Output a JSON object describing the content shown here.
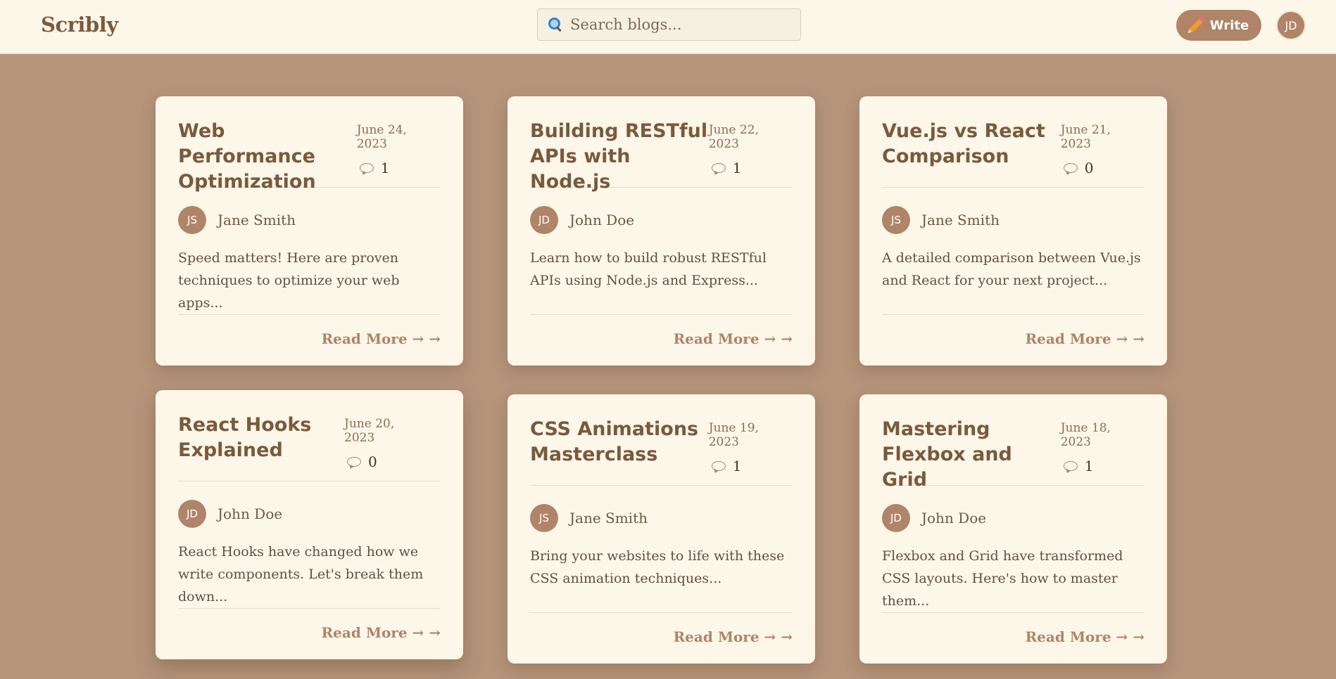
{
  "header": {
    "brand": "Scribly",
    "search_placeholder": "Search blogs...",
    "write_label": "Write",
    "user_initials": "JD"
  },
  "posts": [
    {
      "title": "Web Performance Optimization",
      "date": "June 24, 2023",
      "comments": "1",
      "initials": "JS",
      "author": "Jane Smith",
      "excerpt": "Speed matters! Here are proven techniques to optimize your web apps...",
      "read_more": "Read More → →"
    },
    {
      "title": "Building RESTful APIs with Node.js",
      "date": "June 22, 2023",
      "comments": "1",
      "initials": "JD",
      "author": "John Doe",
      "excerpt": "Learn how to build robust RESTful APIs using Node.js and Express...",
      "read_more": "Read More → →"
    },
    {
      "title": "Vue.js vs React Comparison",
      "date": "June 21, 2023",
      "comments": "0",
      "initials": "JS",
      "author": "Jane Smith",
      "excerpt": "A detailed comparison between Vue.js and React for your next project...",
      "read_more": "Read More → →"
    },
    {
      "title": "React Hooks Explained",
      "date": "June 20, 2023",
      "comments": "0",
      "initials": "JD",
      "author": "John Doe",
      "excerpt": "React Hooks have changed how we write components. Let's break them down...",
      "read_more": "Read More → →"
    },
    {
      "title": "CSS Animations Masterclass",
      "date": "June 19, 2023",
      "comments": "1",
      "initials": "JS",
      "author": "Jane Smith",
      "excerpt": "Bring your websites to life with these CSS animation techniques...",
      "read_more": "Read More → →"
    },
    {
      "title": "Mastering Flexbox and Grid",
      "date": "June 18, 2023",
      "comments": "1",
      "initials": "JD",
      "author": "John Doe",
      "excerpt": "Flexbox and Grid have transformed CSS layouts. Here's how to master them...",
      "read_more": "Read More → →"
    }
  ]
}
